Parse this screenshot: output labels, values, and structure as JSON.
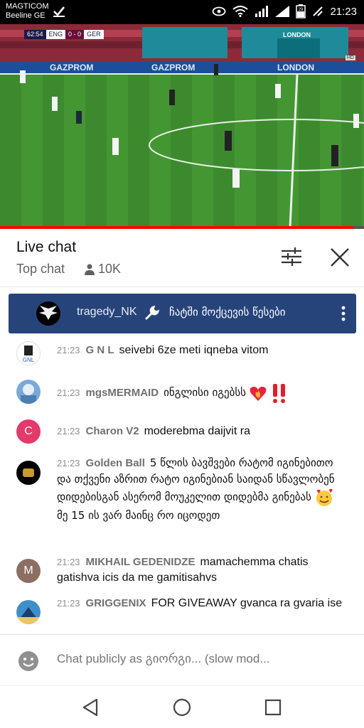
{
  "status_bar": {
    "carrier_line1": "MAGTICOM",
    "carrier_line2": "Beeline GE",
    "battery": "29",
    "time": "21:23"
  },
  "video": {
    "scoreboard": {
      "match_time": "62:54",
      "team1": "ENG",
      "score": "0 - 0",
      "team2": "GER"
    },
    "ad_boards": [
      "GAZPROM",
      "GAZPROM",
      "LONDON"
    ],
    "stand_sign": "LONDON",
    "badge": "HD",
    "progress_fraction": 0.97,
    "accent_color": "#ff0000"
  },
  "chat": {
    "title": "Live chat",
    "mode": "Top chat",
    "viewer_count": "10K",
    "pinned": {
      "author": "tragedy_NK",
      "message": "ჩატში მოქცევის წესები"
    },
    "messages": [
      {
        "time": "21:23",
        "author": "G N L",
        "text": "seivebi 6ze meti iqneba vitom",
        "avatar_letter": "",
        "avatar_color": "#ffffff"
      },
      {
        "time": "21:23",
        "author": "mgsMERMAID",
        "text": "ინგლისი იგებსს",
        "avatar_letter": "",
        "avatar_color": "#7aa9d8"
      },
      {
        "time": "21:23",
        "author": "Charon V2",
        "text": "moderebma daijvit ra",
        "avatar_letter": "C",
        "avatar_color": "#e3396b"
      },
      {
        "time": "21:23",
        "author": "Golden Ball",
        "text": "5 წლის ბავშვები რატომ იგინებითო და თქვენი აზრით რატო იგინებიან საიდან სწავლობენ დიდებისგან ასერომ მოუკელით დიდებმა გინებას",
        "text2": "მე 15 ის ვარ მაინც რო იცოდეთ",
        "avatar_letter": "",
        "avatar_color": "#000000"
      },
      {
        "time": "21:23",
        "author": "MIKHAIL GEDENIDZE",
        "text": "mamachemma chatis gatishva icis da me gamitisahvs",
        "avatar_letter": "M",
        "avatar_color": "#8d6e63"
      },
      {
        "time": "21:23",
        "author": "GRIGGENIX",
        "text": "FOR GIVEAWAY gvanca ra gvaria ise",
        "avatar_letter": "",
        "avatar_color": "#3e8fc8"
      }
    ],
    "input_placeholder": "Chat publicly as გიორგი... (slow mod..."
  }
}
